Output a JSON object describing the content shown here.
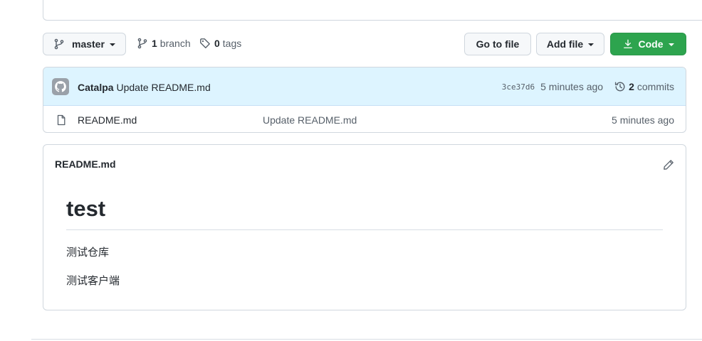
{
  "toolbar": {
    "branch_name": "master",
    "branch_count": "1",
    "branch_label": "branch",
    "tag_count": "0",
    "tag_label": "tags",
    "goto_file_label": "Go to file",
    "add_file_label": "Add file",
    "code_label": "Code",
    "code_button_color": "#2da44e"
  },
  "latest_commit": {
    "author": "Catalpa",
    "message": "Update README.md",
    "sha": "3ce37d6",
    "time": "5 minutes ago",
    "commit_count": "2",
    "commit_label": "commits",
    "background_color": "#ddf4ff"
  },
  "files": [
    {
      "icon": "file-icon",
      "name": "README.md",
      "commit_message": "Update README.md",
      "time": "5 minutes ago"
    }
  ],
  "readme": {
    "filename": "README.md",
    "heading": "test",
    "paragraphs": [
      "测试仓库",
      "测试客户端"
    ]
  }
}
